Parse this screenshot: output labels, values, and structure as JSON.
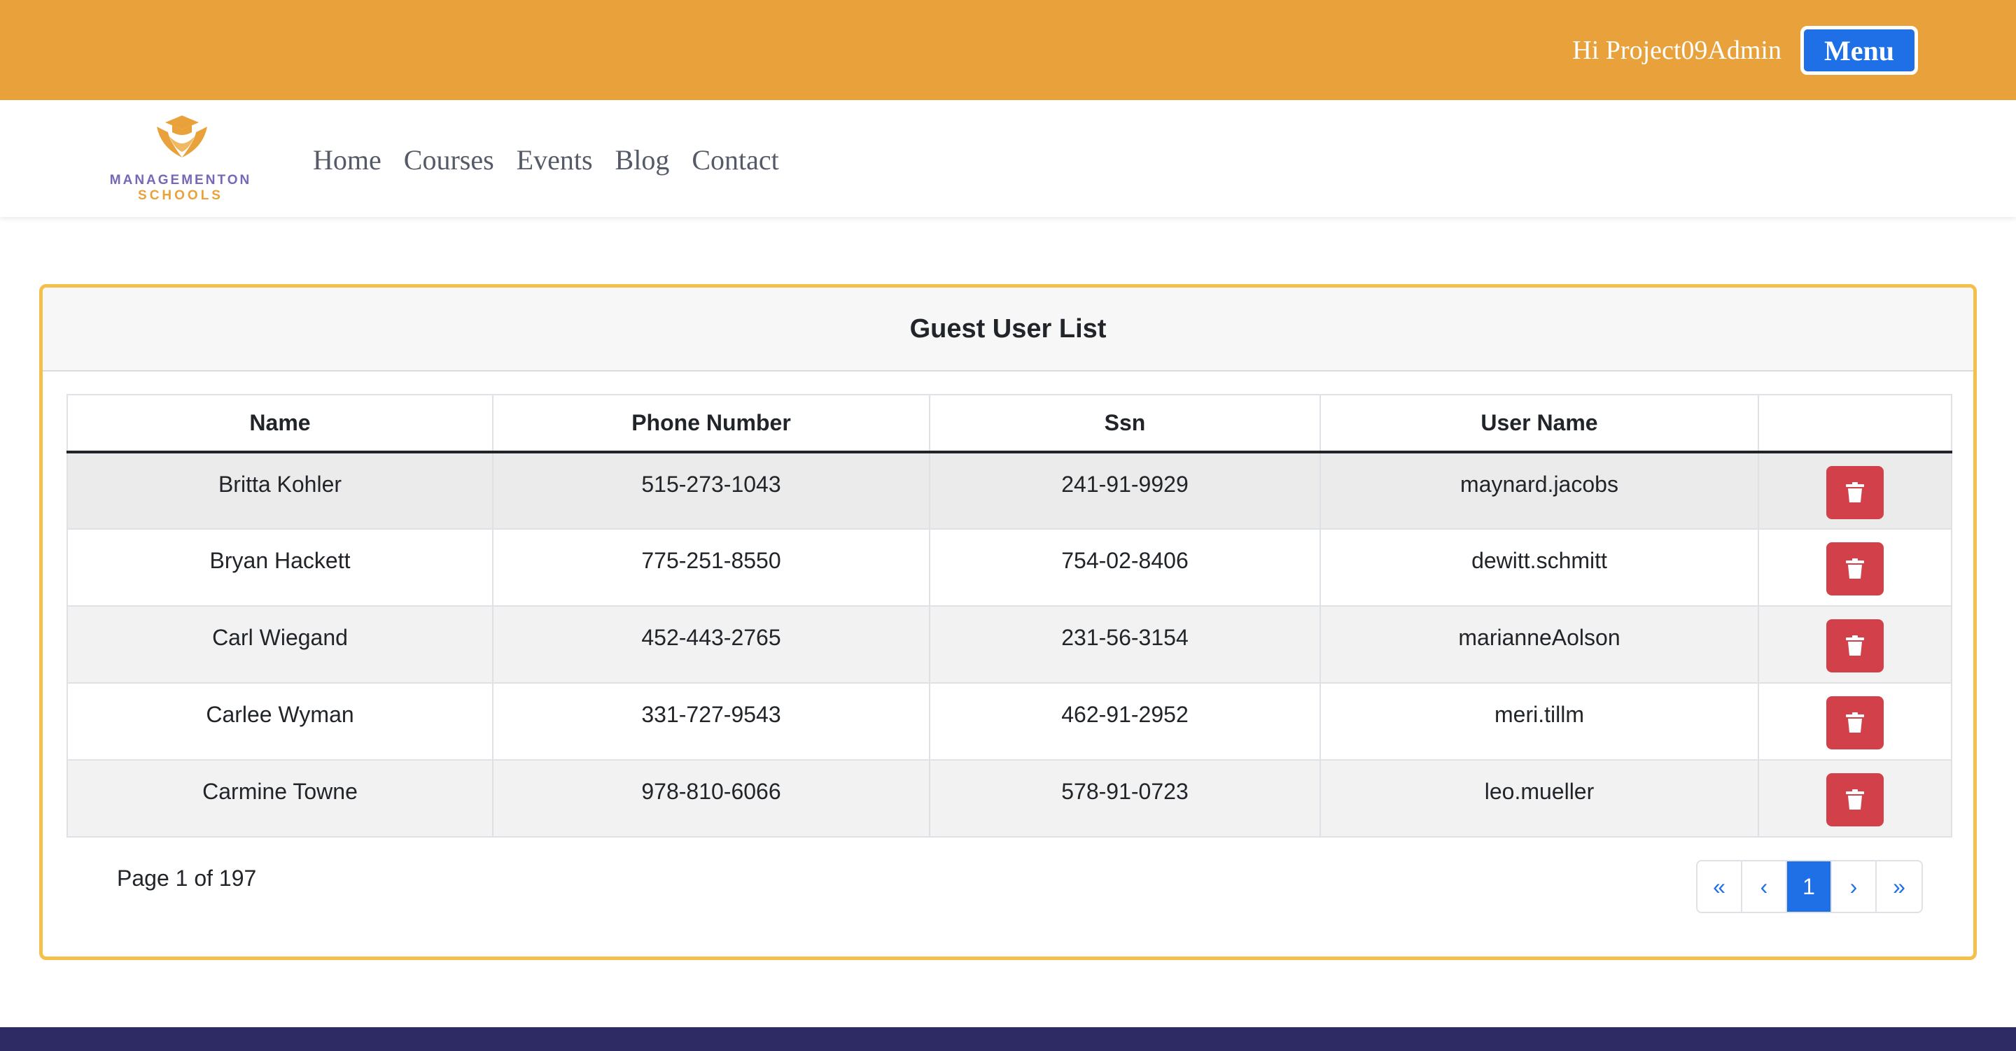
{
  "header": {
    "greeting": "Hi Project09Admin",
    "menu_label": "Menu"
  },
  "logo": {
    "line1": "MANAGEMENTON",
    "line2": "SCHOOLS"
  },
  "nav": {
    "items": [
      "Home",
      "Courses",
      "Events",
      "Blog",
      "Contact"
    ]
  },
  "card": {
    "title": "Guest User List"
  },
  "table": {
    "columns": [
      "Name",
      "Phone Number",
      "Ssn",
      "User Name",
      ""
    ],
    "rows": [
      {
        "name": "Britta Kohler",
        "phone": "515-273-1043",
        "ssn": "241-91-9929",
        "username": "maynard.jacobs"
      },
      {
        "name": "Bryan Hackett",
        "phone": "775-251-8550",
        "ssn": "754-02-8406",
        "username": "dewitt.schmitt"
      },
      {
        "name": "Carl Wiegand",
        "phone": "452-443-2765",
        "ssn": "231-56-3154",
        "username": "marianneAolson"
      },
      {
        "name": "Carlee Wyman",
        "phone": "331-727-9543",
        "ssn": "462-91-2952",
        "username": "meri.tillm"
      },
      {
        "name": "Carmine Towne",
        "phone": "978-810-6066",
        "ssn": "578-91-0723",
        "username": "leo.mueller"
      }
    ]
  },
  "pagination": {
    "info": "Page 1 of 197",
    "first": "«",
    "prev": "‹",
    "current": "1",
    "next": "›",
    "last": "»"
  },
  "colors": {
    "topbar": "#e9a23b",
    "accent": "#1f6fe6",
    "card_border": "#f4c04a",
    "delete": "#d2404a",
    "footer": "#2e2a63"
  },
  "icons": {
    "delete": "trash-icon",
    "logo": "graduation-cap-icon"
  }
}
